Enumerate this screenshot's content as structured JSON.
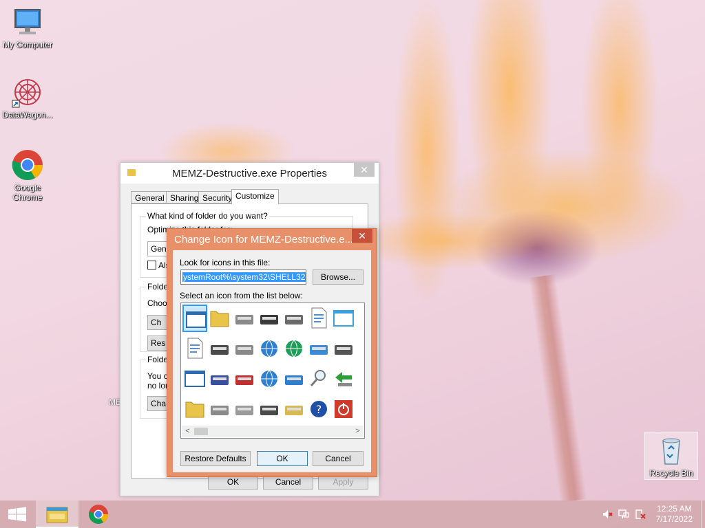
{
  "desktop": {
    "icons": [
      {
        "label": "My Computer",
        "icon": "monitor-icon"
      },
      {
        "label": "DataWagon...",
        "icon": "datawagon-icon"
      },
      {
        "label": "Google Chrome",
        "icon": "chrome-icon"
      },
      {
        "label": "Recycle Bin",
        "icon": "recycle-bin-icon"
      }
    ],
    "partial_label": "ME"
  },
  "properties_window": {
    "title": "MEMZ-Destructive.exe Properties",
    "close_glyph": "✕",
    "tabs": [
      "General",
      "Sharing",
      "Security",
      "Customize"
    ],
    "active_tab": "Customize",
    "group1_label": "What kind of folder do you want?",
    "optimize_text": "Optimize this folder for:",
    "optimize_value": "Gene",
    "also_apply_text": "Als",
    "group2_label": "Folder",
    "choose_text": "Choos",
    "choose_file_btn": "Ch",
    "restore_default_btn": "Res",
    "group3_label": "Folder",
    "icon_text_line1": "You ca",
    "icon_text_line2": "no lon",
    "change_icon_btn": "Cha",
    "ok_label": "OK",
    "cancel_label": "Cancel",
    "apply_label": "Apply"
  },
  "change_icon_dialog": {
    "title": "Change Icon for MEMZ-Destructive.e...",
    "close_glyph": "✕",
    "look_label": "Look for icons in this file:",
    "file_path": "ystemRoot%\\system32\\SHELL32.dll",
    "browse_label": "Browse...",
    "select_label": "Select an icon from the list below:",
    "restore_defaults_label": "Restore Defaults",
    "ok_label": "OK",
    "cancel_label": "Cancel",
    "scroll_left": "<",
    "scroll_right": ">",
    "icons": [
      "blank-window-icon",
      "folder-icon",
      "drive-icon",
      "chip-icon",
      "printer-icon",
      "clock-document-icon",
      "monitor-window-icon",
      "document-icon",
      "computer-icon",
      "network-drive-icon",
      "globe-icon",
      "network-globe-icon",
      "control-panel-icon",
      "settings-icon",
      "window-icon",
      "save-disk-icon",
      "disconnected-drive-icon",
      "globe-mouse-icon",
      "network-icon",
      "search-icon",
      "back-arrow-icon",
      "folder-icon",
      "drive-icon",
      "cd-drive-icon",
      "computer-icon",
      "calculator-icon",
      "help-icon",
      "power-icon"
    ]
  },
  "taskbar": {
    "time": "12:25 AM",
    "date": "7/17/2022"
  },
  "colors": {
    "dialog_accent": "#e8906a",
    "selection": "#3399ff",
    "taskbar": "#d2aaaf"
  }
}
